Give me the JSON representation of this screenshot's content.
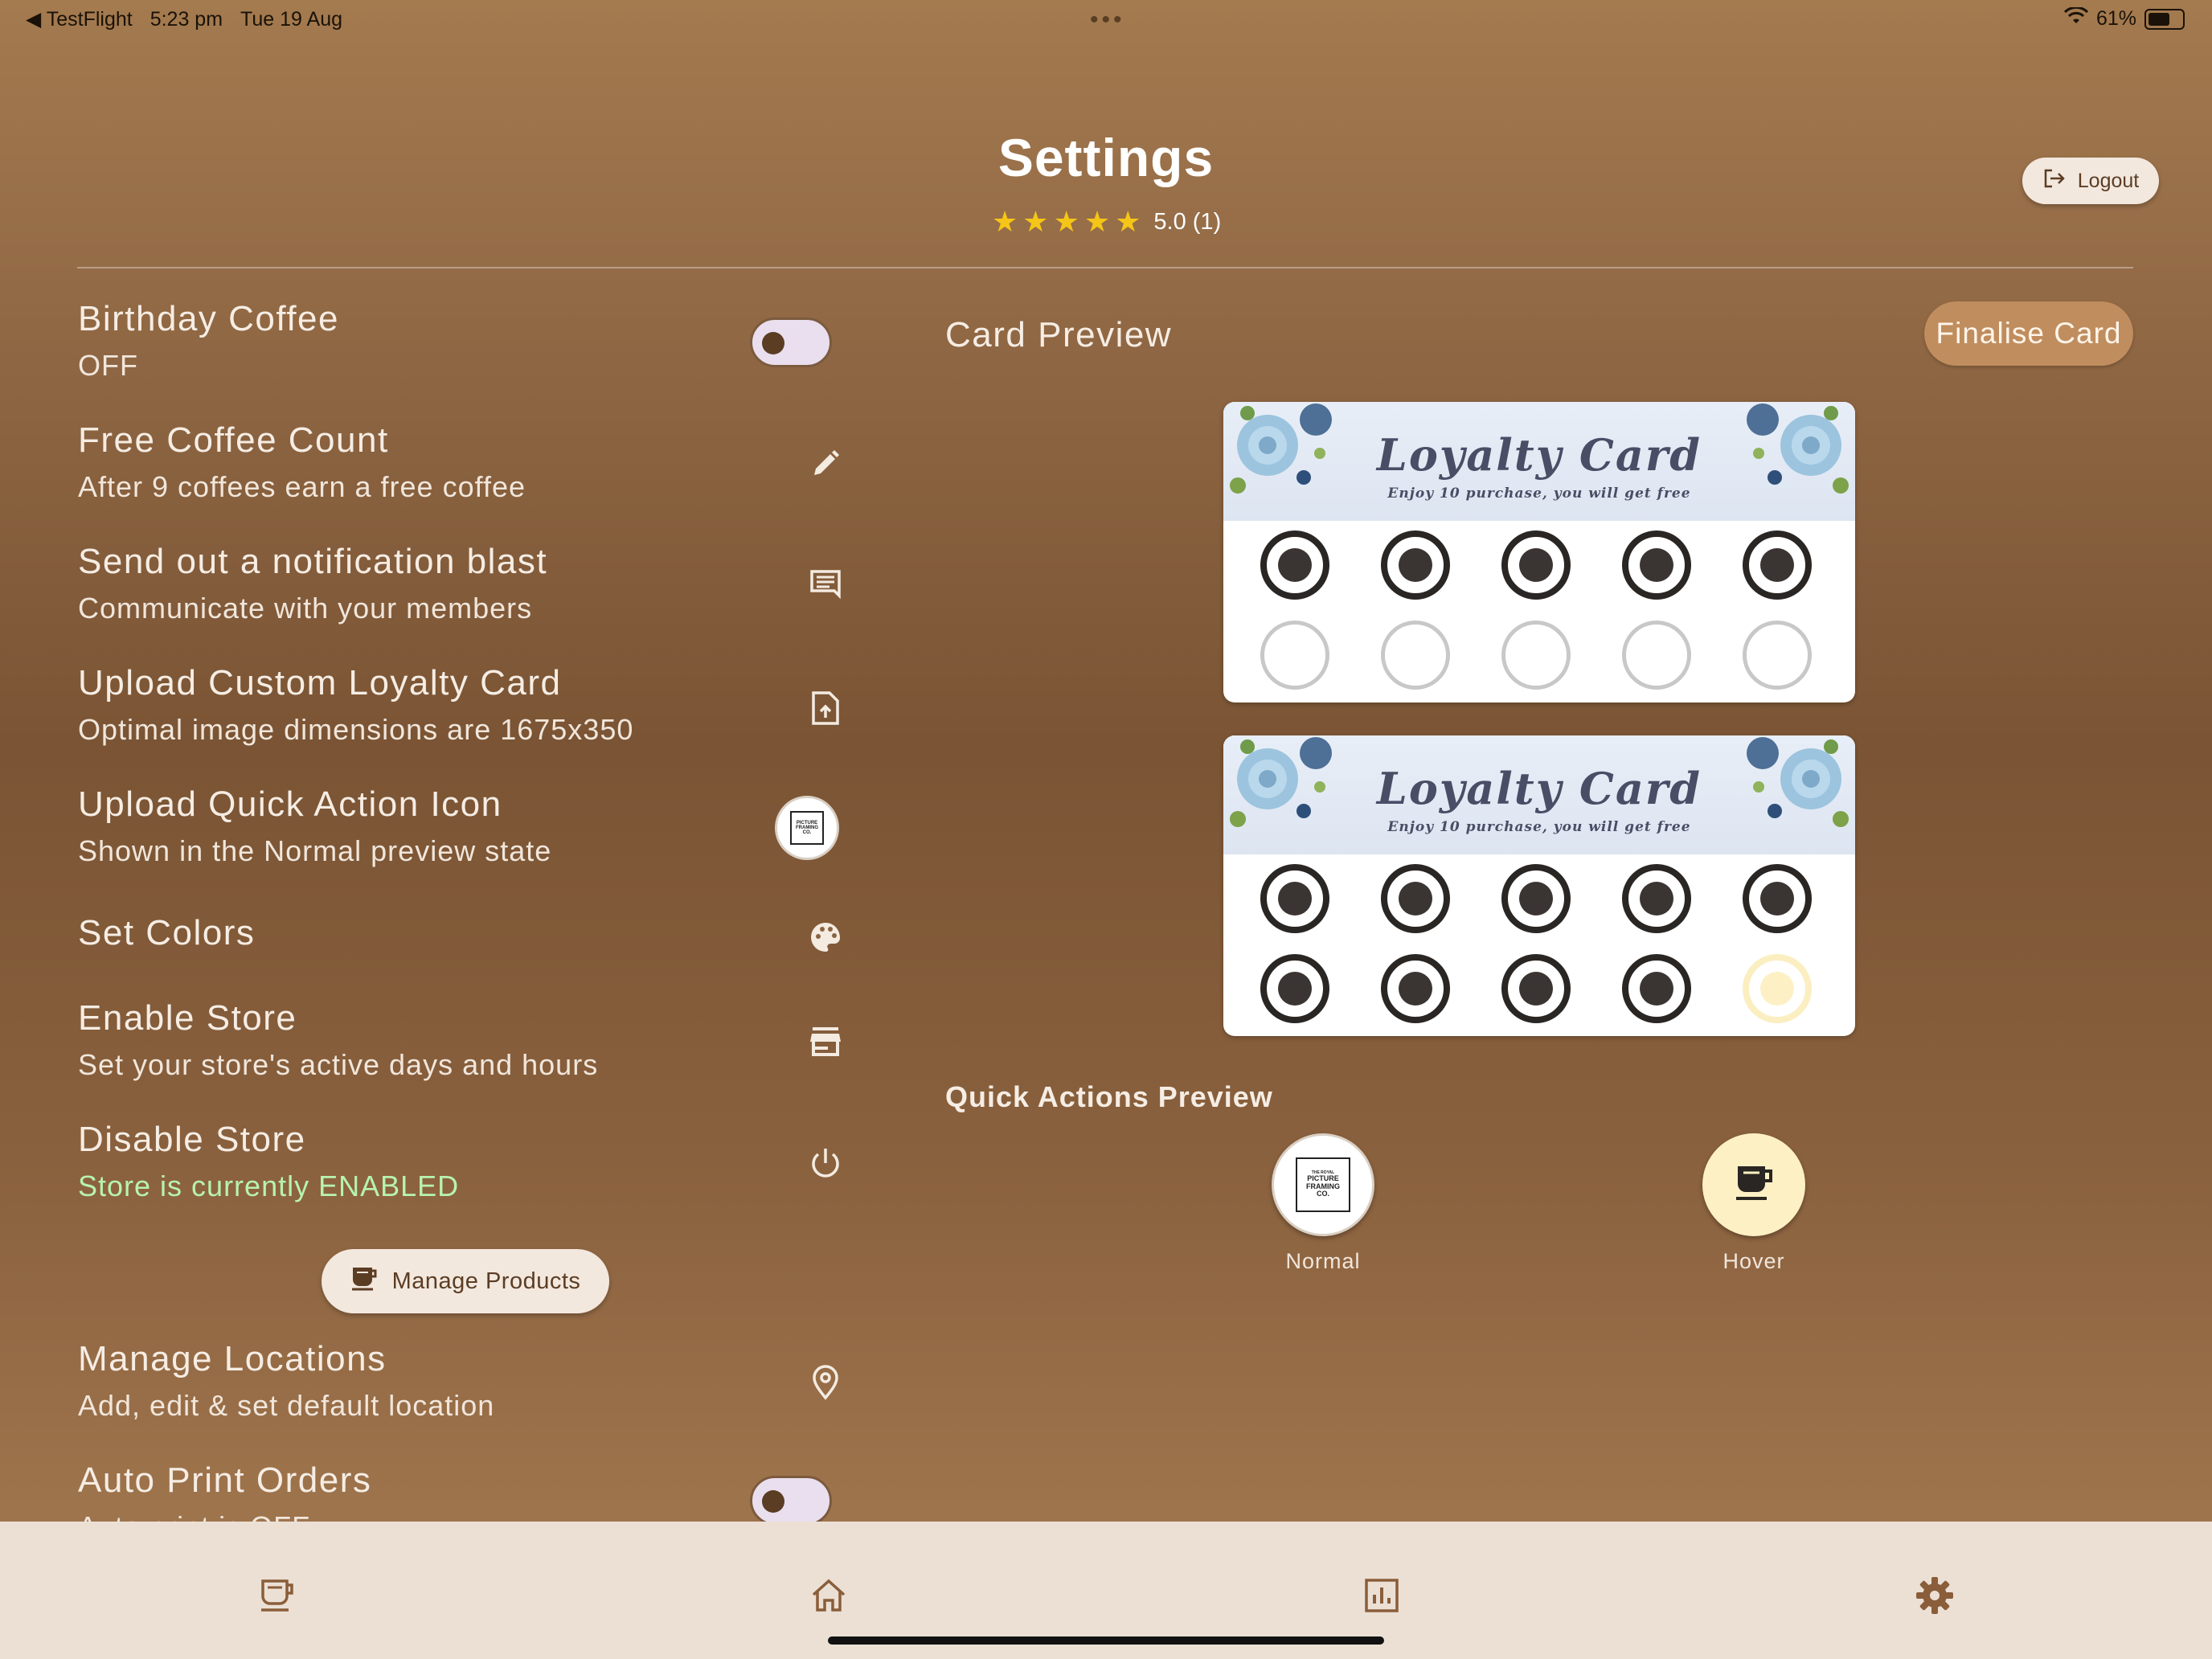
{
  "status_bar": {
    "back_app": "◀ TestFlight",
    "time": "5:23 pm",
    "date": "Tue 19 Aug",
    "battery": "61%",
    "battery_level": 0.61
  },
  "header": {
    "title": "Settings",
    "rating_value": "5.0 (1)",
    "stars": 5,
    "logout_label": "Logout"
  },
  "settings": [
    {
      "title": "Birthday Coffee",
      "subtitle": "OFF",
      "control": "toggle",
      "on": false
    },
    {
      "title": "Free Coffee Count",
      "subtitle": "After 9 coffees earn a free coffee",
      "icon": "pencil-icon"
    },
    {
      "title": "Send out a notification blast",
      "subtitle": "Communicate with your members",
      "icon": "message-icon"
    },
    {
      "title": "Upload Custom Loyalty Card",
      "subtitle": "Optimal image dimensions are 1675x350",
      "icon": "file-upload-icon"
    },
    {
      "title": "Upload Quick Action Icon",
      "subtitle": "Shown in the Normal preview state",
      "icon": "quick-action-avatar"
    },
    {
      "title": "Set Colors",
      "subtitle": "",
      "icon": "palette-icon"
    },
    {
      "title": "Enable Store",
      "subtitle": "Set your store's active days and hours",
      "icon": "store-icon"
    },
    {
      "title": "Disable Store",
      "subtitle": "Store is currently ENABLED",
      "icon": "power-icon"
    },
    {
      "title": "Manage Locations",
      "subtitle": "Add, edit & set default location",
      "icon": "location-pin-icon"
    },
    {
      "title": "Auto Print Orders",
      "subtitle": "Auto print is OFF",
      "control": "toggle",
      "on": false
    }
  ],
  "manage_products_label": "Manage Products",
  "preview": {
    "card_preview_title": "Card Preview",
    "finalise_label": "Finalise Card",
    "loyalty_card_title": "Loyalty Card",
    "loyalty_card_subtitle": "Enjoy 10 purchase, you will get free",
    "cards": [
      {
        "stamps": [
          "filled",
          "filled",
          "filled",
          "filled",
          "filled",
          "empty",
          "empty",
          "empty",
          "empty",
          "empty"
        ]
      },
      {
        "stamps": [
          "filled",
          "filled",
          "filled",
          "filled",
          "filled",
          "filled",
          "filled",
          "filled",
          "filled",
          "hover"
        ]
      }
    ],
    "quick_actions_title": "Quick Actions Preview",
    "normal_label": "Normal",
    "hover_label": "Hover",
    "logo_text": {
      "line1": "THE ROYAL",
      "line2": "PICTURE",
      "line3": "FRAMING",
      "line4": "CO."
    }
  },
  "bottom_nav": [
    {
      "icon": "coffee-cup-icon",
      "active": false
    },
    {
      "icon": "home-icon",
      "active": false
    },
    {
      "icon": "chart-icon",
      "active": false
    },
    {
      "icon": "gear-icon",
      "active": true
    }
  ],
  "colors": {
    "accent": "#c08d5e",
    "nav_icon": "#8a5e3a",
    "enabled_green": "#b7f3b0",
    "star": "#f5c518"
  }
}
